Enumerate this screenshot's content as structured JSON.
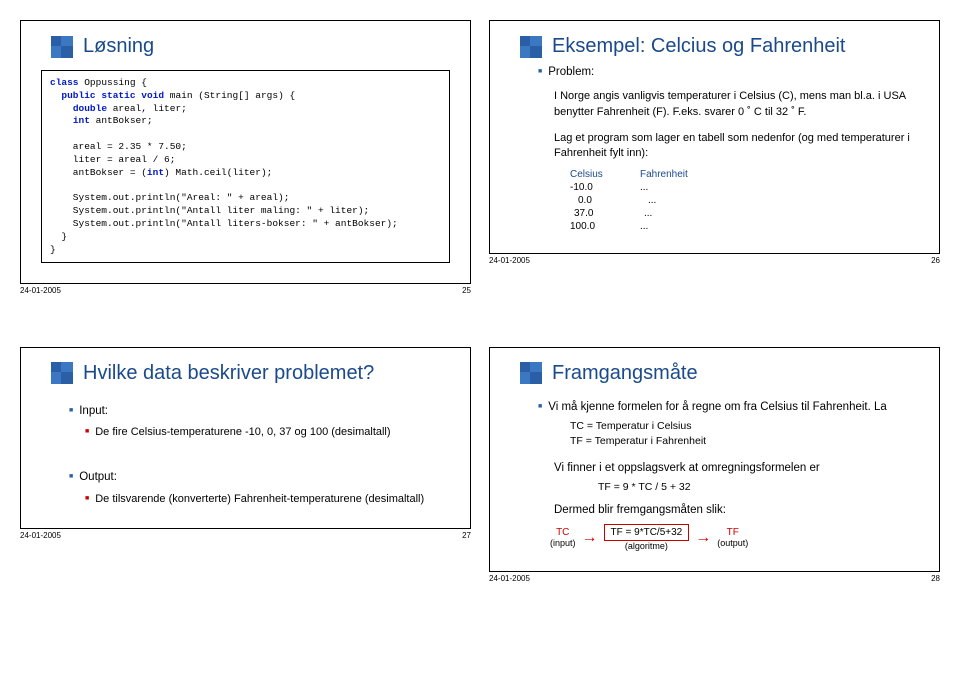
{
  "date": "24-01-2005",
  "slides": {
    "s25": {
      "num": "25",
      "title": "Løsning",
      "code_lines": [
        {
          "t": "class Oppussing {",
          "indent": 0
        },
        {
          "t": "public static void main (String[] args) {",
          "indent": 1,
          "kw": [
            "public",
            "static",
            "void"
          ]
        },
        {
          "t": "double areal, liter;",
          "indent": 2,
          "kw": [
            "double"
          ]
        },
        {
          "t": "int antBokser;",
          "indent": 2,
          "kw": [
            "int"
          ]
        },
        {
          "t": "",
          "indent": 0
        },
        {
          "t": "areal = 2.35 * 7.50;",
          "indent": 2
        },
        {
          "t": "liter = areal / 6;",
          "indent": 2
        },
        {
          "t": "antBokser = (int) Math.ceil(liter);",
          "indent": 2,
          "kw": [
            "int"
          ]
        },
        {
          "t": "",
          "indent": 0
        },
        {
          "t": "System.out.println(\"Areal: \" + areal);",
          "indent": 2
        },
        {
          "t": "System.out.println(\"Antall liter maling: \" + liter);",
          "indent": 2
        },
        {
          "t": "System.out.println(\"Antall liters-bokser: \" + antBokser);",
          "indent": 2
        },
        {
          "t": "}",
          "indent": 1
        },
        {
          "t": "}",
          "indent": 0
        }
      ]
    },
    "s26": {
      "num": "26",
      "title": "Eksempel: Celcius og Fahrenheit",
      "problem_label": "Problem:",
      "p1": "I Norge angis vanligvis temperaturer i Celsius (C), mens man bl.a. i USA benytter Fahrenheit (F). F.eks. svarer 0 ˚ C til 32 ˚ F.",
      "p2": "Lag et program som lager en tabell som nedenfor (og med temperaturer i Fahrenheit fylt inn):",
      "table": {
        "h1": "Celsius",
        "h2": "Fahrenheit",
        "rows": [
          {
            "c": "-10.0",
            "f": "..."
          },
          {
            "c": "0.0",
            "f": "..."
          },
          {
            "c": "37.0",
            "f": "..."
          },
          {
            "c": "100.0",
            "f": "..."
          }
        ]
      }
    },
    "s27": {
      "num": "27",
      "title": "Hvilke data beskriver problemet?",
      "input_label": "Input:",
      "input_text": "De fire Celsius-temperaturene -10, 0, 37 og 100 (desimaltall)",
      "output_label": "Output:",
      "output_text": "De tilsvarende (konverterte) Fahrenheit-temperaturene (desimaltall)"
    },
    "s28": {
      "num": "28",
      "title": "Framgangsmåte",
      "line1": "Vi må kjenne formelen for å regne om fra Celsius til Fahrenheit. La",
      "tc": "TC = Temperatur i Celsius",
      "tf": "TF  = Temperatur i Fahrenheit",
      "line2": "Vi finner i et oppslagsverk at omregningsformelen er",
      "formula": "TF  =  9 * TC / 5 + 32",
      "line3": "Dermed blir fremgangsmåten slik:",
      "flow": {
        "tc": "TC",
        "tf": "TF",
        "mid": "TF = 9*TC/5+32",
        "b1": "(input)",
        "b2": "(algoritme)",
        "b3": "(output)"
      }
    }
  }
}
